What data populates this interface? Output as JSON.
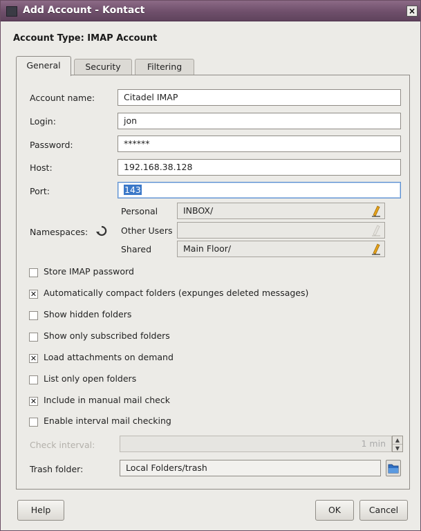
{
  "window": {
    "title": "Add Account - Kontact"
  },
  "account_type": "Account Type: IMAP Account",
  "tabs": [
    {
      "label": "General",
      "active": true
    },
    {
      "label": "Security",
      "active": false
    },
    {
      "label": "Filtering",
      "active": false
    }
  ],
  "form": {
    "account_name": {
      "label": "Account name:",
      "value": "Citadel IMAP"
    },
    "login": {
      "label": "Login:",
      "value": "jon"
    },
    "password": {
      "label": "Password:",
      "value": "******"
    },
    "host": {
      "label": "Host:",
      "value": "192.168.38.128"
    },
    "port": {
      "label": "Port:",
      "value": "143"
    }
  },
  "namespaces": {
    "label": "Namespaces:",
    "rows": [
      {
        "label": "Personal",
        "value": "INBOX/"
      },
      {
        "label": "Other Users",
        "value": ""
      },
      {
        "label": "Shared",
        "value": "Main Floor/"
      }
    ]
  },
  "options": [
    {
      "label": "Store IMAP password",
      "checked": false
    },
    {
      "label": "Automatically compact folders (expunges deleted messages)",
      "checked": true
    },
    {
      "label": "Show hidden folders",
      "checked": false
    },
    {
      "label": "Show only subscribed folders",
      "checked": false
    },
    {
      "label": "Load attachments on demand",
      "checked": true
    },
    {
      "label": "List only open folders",
      "checked": false
    },
    {
      "label": "Include in manual mail check",
      "checked": true
    },
    {
      "label": "Enable interval mail checking",
      "checked": false
    }
  ],
  "check_interval": {
    "label": "Check interval:",
    "value": "1 min"
  },
  "trash_folder": {
    "label": "Trash folder:",
    "value": "Local Folders/trash"
  },
  "buttons": {
    "help": "Help",
    "ok": "OK",
    "cancel": "Cancel"
  },
  "colors": {
    "titlebar": "#6f4f6b",
    "dialog_bg": "#ecebe7",
    "focus": "#5a8ed0",
    "edit_icon": "#e6a21a"
  }
}
